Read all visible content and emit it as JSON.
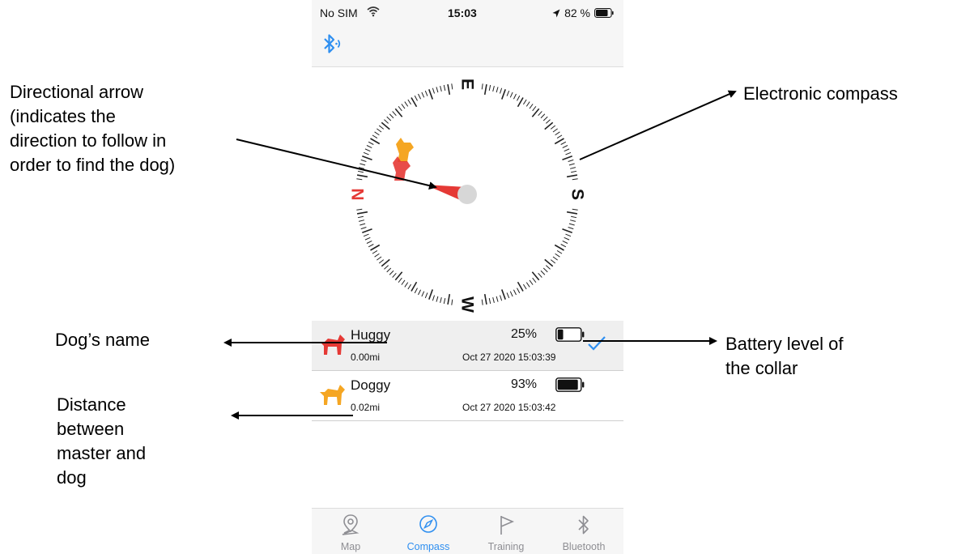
{
  "status_bar": {
    "carrier": "No SIM",
    "time": "15:03",
    "battery_pct": "82 %",
    "battery_level": 0.82
  },
  "nav": {
    "bluetooth_icon": "bluetooth-signal-icon",
    "accent": "#2f8ff0"
  },
  "compass": {
    "labels": {
      "top": "E",
      "right": "S",
      "bottom": "W",
      "left": "N"
    },
    "north_color": "#e53935",
    "arrow_color": "#e53935"
  },
  "dogs": [
    {
      "name": "Huggy",
      "distance": "0.00mi",
      "battery_pct": "25%",
      "battery_level": 0.25,
      "timestamp": "Oct 27 2020 15:03:39",
      "selected": true,
      "color": "#e53935"
    },
    {
      "name": "Doggy",
      "distance": "0.02mi",
      "battery_pct": "93%",
      "battery_level": 0.93,
      "timestamp": "Oct 27 2020 15:03:42",
      "selected": false,
      "color": "#f5a623"
    }
  ],
  "tabs": [
    {
      "label": "Map",
      "icon": "map-pin-icon",
      "active": false
    },
    {
      "label": "Compass",
      "icon": "compass-icon",
      "active": true
    },
    {
      "label": "Training",
      "icon": "flag-icon",
      "active": false
    },
    {
      "label": "Bluetooth",
      "icon": "bluetooth-icon",
      "active": false
    }
  ],
  "annotations": {
    "directional_arrow": [
      "Directional arrow",
      "(indicates the",
      "direction to follow in",
      "order to find the dog)"
    ],
    "electronic_compass": "Electronic compass",
    "dog_name": "Dog’s name",
    "distance": [
      "Distance",
      "between",
      "master and",
      "dog"
    ],
    "battery": [
      "Battery level of",
      "the collar"
    ]
  }
}
